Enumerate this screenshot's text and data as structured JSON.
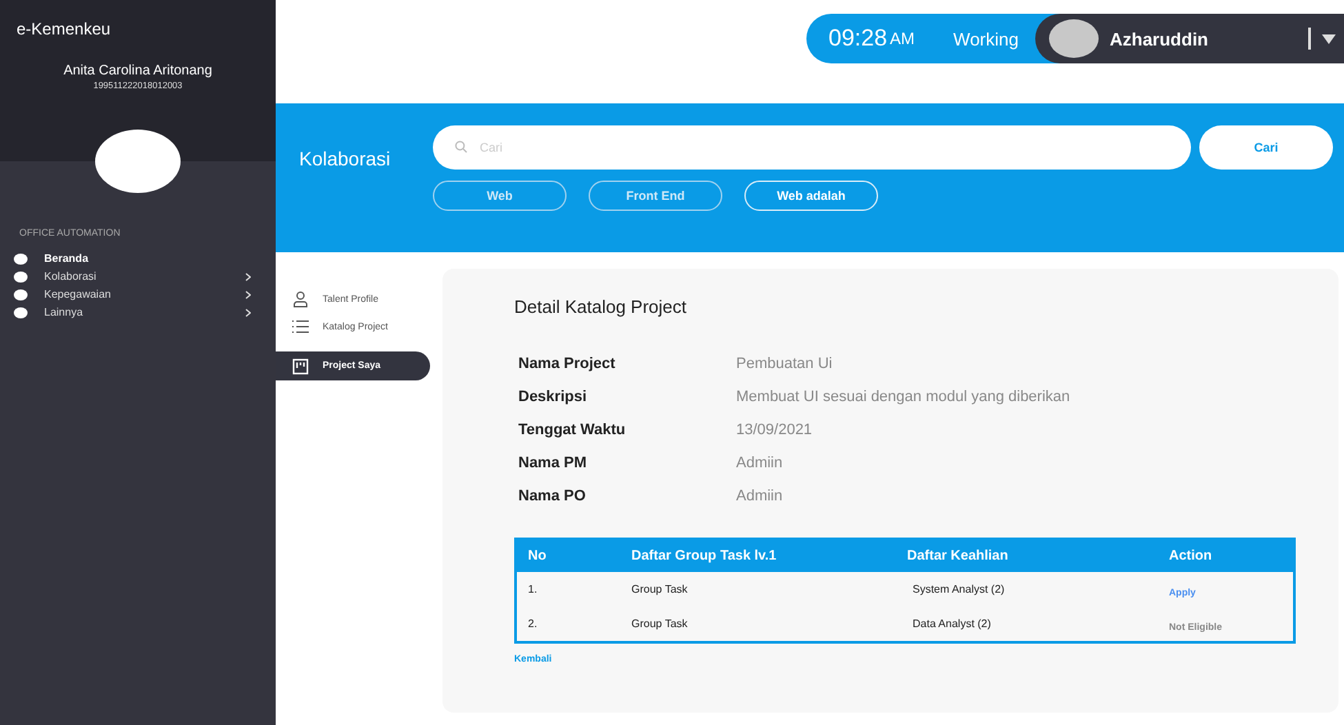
{
  "sidebar": {
    "app_title": "e-Kemenkeu",
    "user_name": "Anita Carolina Aritonang",
    "user_id": "199511222018012003",
    "section": "OFFICE AUTOMATION",
    "items": [
      {
        "label": "Beranda",
        "selected": true,
        "has_children": false
      },
      {
        "label": "Kolaborasi",
        "selected": false,
        "has_children": true
      },
      {
        "label": "Kepegawaian",
        "selected": false,
        "has_children": true
      },
      {
        "label": "Lainnya",
        "selected": false,
        "has_children": true
      }
    ]
  },
  "status_bar": {
    "time": "09:28",
    "meridiem": "AM",
    "status": "Working",
    "user": "Azharuddin"
  },
  "search_band": {
    "title": "Kolaborasi",
    "placeholder": "Cari",
    "button": "Cari",
    "chips": [
      {
        "label": "Web",
        "selected": false
      },
      {
        "label": "Front End",
        "selected": false
      },
      {
        "label": "Web adalah",
        "selected": true
      }
    ]
  },
  "sub_nav": [
    {
      "label": "Talent Profile",
      "kind": "person",
      "selected": false
    },
    {
      "label": "Katalog Project",
      "kind": "list",
      "selected": false
    },
    {
      "label": "Project Saya",
      "kind": "board",
      "selected": true
    }
  ],
  "detail": {
    "title": "Detail Katalog Project",
    "fields": [
      {
        "label": "Nama Project",
        "value": "Pembuatan  Ui"
      },
      {
        "label": "Deskripsi",
        "value": "Membuat UI sesuai dengan modul yang diberikan"
      },
      {
        "label": "Tenggat Waktu",
        "value": "13/09/2021"
      },
      {
        "label": "Nama PM",
        "value": "Admiin"
      },
      {
        "label": "Nama PO",
        "value": "Admiin"
      }
    ],
    "table": {
      "columns": [
        "No",
        "Daftar Group Task lv.1",
        "Daftar Keahlian",
        "Action"
      ],
      "rows": [
        {
          "no": "1.",
          "task": "Group Task",
          "skill": "System Analyst (2)",
          "action": "Apply",
          "eligible": true
        },
        {
          "no": "2.",
          "task": "Group Task",
          "skill": "Data Analyst (2)",
          "action": "Not Eligible",
          "eligible": false
        }
      ]
    },
    "back_link": "Kembali"
  }
}
